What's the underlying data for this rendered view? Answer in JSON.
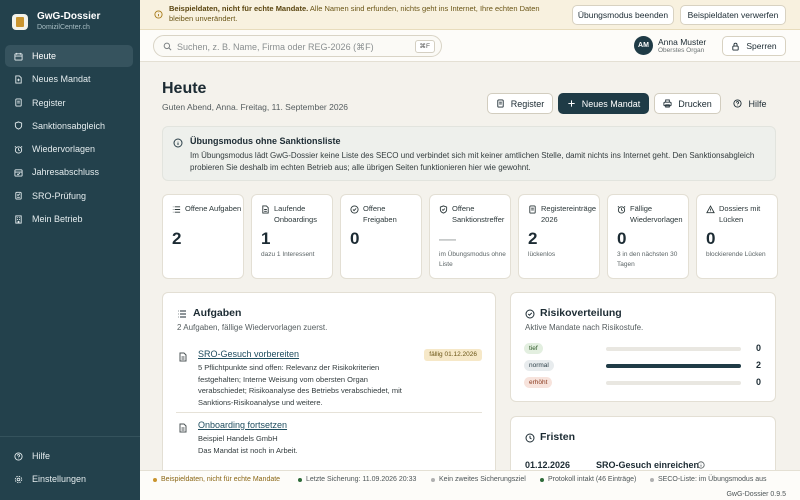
{
  "app": {
    "name": "GwG-Dossier",
    "subtitle": "DomizilCenter.ch"
  },
  "sidebar": {
    "items": [
      {
        "label": "Heute",
        "icon": "calendar-icon",
        "active": true
      },
      {
        "label": "Neues Mandat",
        "icon": "file-plus-icon"
      },
      {
        "label": "Register",
        "icon": "register-icon"
      },
      {
        "label": "Sanktionsabgleich",
        "icon": "shield-icon"
      },
      {
        "label": "Wiedervorlagen",
        "icon": "clock-icon"
      },
      {
        "label": "Jahresabschluss",
        "icon": "calendar-check-icon"
      },
      {
        "label": "SRO-Prüfung",
        "icon": "clipboard-icon"
      },
      {
        "label": "Mein Betrieb",
        "icon": "building-icon"
      }
    ],
    "bottom": [
      {
        "label": "Hilfe",
        "icon": "help-icon"
      },
      {
        "label": "Einstellungen",
        "icon": "settings-icon"
      }
    ]
  },
  "banner": {
    "strong": "Beispieldaten, nicht für echte Mandate.",
    "text": " Alle Namen sind erfunden, nichts geht ins Internet, Ihre echten Daten bleiben unverändert.",
    "btn_end": "Übungsmodus beenden",
    "btn_discard": "Beispieldaten verwerfen"
  },
  "topbar": {
    "search_placeholder": "Suchen, z. B. Name, Firma oder REG-2026 (⌘F)",
    "shortcut": "⌘F",
    "avatar": "AM",
    "user_name": "Anna Muster",
    "user_role": "Oberstes Organ",
    "lock_label": "Sperren"
  },
  "page": {
    "title": "Heute",
    "subtitle": "Guten Abend, Anna. Freitag, 11. September 2026",
    "btn_register": "Register",
    "btn_new": "Neues Mandat",
    "btn_print": "Drucken",
    "btn_help": "Hilfe"
  },
  "info": {
    "title": "Übungsmodus ohne Sanktionsliste",
    "body": "Im Übungsmodus lädt GwG-Dossier keine Liste des SECO und verbindet sich mit keiner amtlichen Stelle, damit nichts ins Internet geht. Den Sanktionsabgleich probieren Sie deshalb im echten Betrieb aus; alle übrigen Seiten funktionieren hier wie gewohnt."
  },
  "stats": [
    {
      "label": "Offene Aufgaben",
      "value": "2",
      "sub": "",
      "icon": "list-icon"
    },
    {
      "label": "Laufende Onboardings",
      "value": "1",
      "sub": "dazu 1 Interessent",
      "icon": "document-icon"
    },
    {
      "label": "Offene Freigaben",
      "value": "0",
      "sub": "",
      "icon": "check-circle-icon"
    },
    {
      "label": "Offene Sanktionstreffer",
      "value": "—",
      "sub": "im Übungsmodus ohne Liste",
      "icon": "shield-check-icon"
    },
    {
      "label": "Registereinträge 2026",
      "value": "2",
      "sub": "lückenlos",
      "icon": "register-icon"
    },
    {
      "label": "Fällige Wiedervorlagen",
      "value": "0",
      "sub": "3 in den nächsten 30 Tagen",
      "icon": "alarm-icon"
    },
    {
      "label": "Dossiers mit Lücken",
      "value": "0",
      "sub": "blockierende Lücken",
      "icon": "warning-icon"
    }
  ],
  "tasks": {
    "title": "Aufgaben",
    "subtitle": "2 Aufgaben, fällige Wiedervorlagen zuerst.",
    "items": [
      {
        "title": "SRO-Gesuch vorbereiten",
        "body": "5 Pflichtpunkte sind offen: Relevanz der Risikokriterien festgehalten; Interne Weisung vom obersten Organ verabschiedet; Risikoanalyse des Betriebs verabschiedet, mit Sanktions-Risikoanalyse und weitere.",
        "tag": "fällig 01.12.2026"
      },
      {
        "title": "Onboarding fortsetzen",
        "body": "Beispiel Handels GmbH\nDas Mandat ist noch in Arbeit.",
        "tag": ""
      }
    ]
  },
  "risk": {
    "title": "Risikoverteilung",
    "subtitle": "Aktive Mandate nach Risikostufe.",
    "rows": [
      {
        "label": "tief",
        "count": 0,
        "share": 0,
        "bg": "#e3efe0",
        "fg": "#2f5a2a"
      },
      {
        "label": "normal",
        "count": 2,
        "share": 1,
        "bg": "#e8ecee",
        "fg": "#2b3f48"
      },
      {
        "label": "erhöht",
        "count": 0,
        "share": 0,
        "bg": "#f7e3dc",
        "fg": "#8a3a1f"
      }
    ]
  },
  "deadlines": {
    "title": "Fristen",
    "items": [
      {
        "date": "01.12.2026",
        "label": "SRO-Gesuch einreichen"
      }
    ]
  },
  "footer": {
    "items": [
      {
        "text": "Beispieldaten, nicht für echte Mandate",
        "color": "#c9942e"
      },
      {
        "text": "Letzte Sicherung: 11.09.2026 20:33",
        "color": "#2f6b3a"
      },
      {
        "text": "Kein zweites Sicherungsziel",
        "color": "#b0b0b0"
      },
      {
        "text": "Protokoll intakt (46 Einträge)",
        "color": "#2f6b3a"
      },
      {
        "text": "SECO-Liste: im Übungsmodus aus",
        "color": "#b0b0b0"
      }
    ],
    "version": "GwG-Dossier 0.9.5"
  }
}
